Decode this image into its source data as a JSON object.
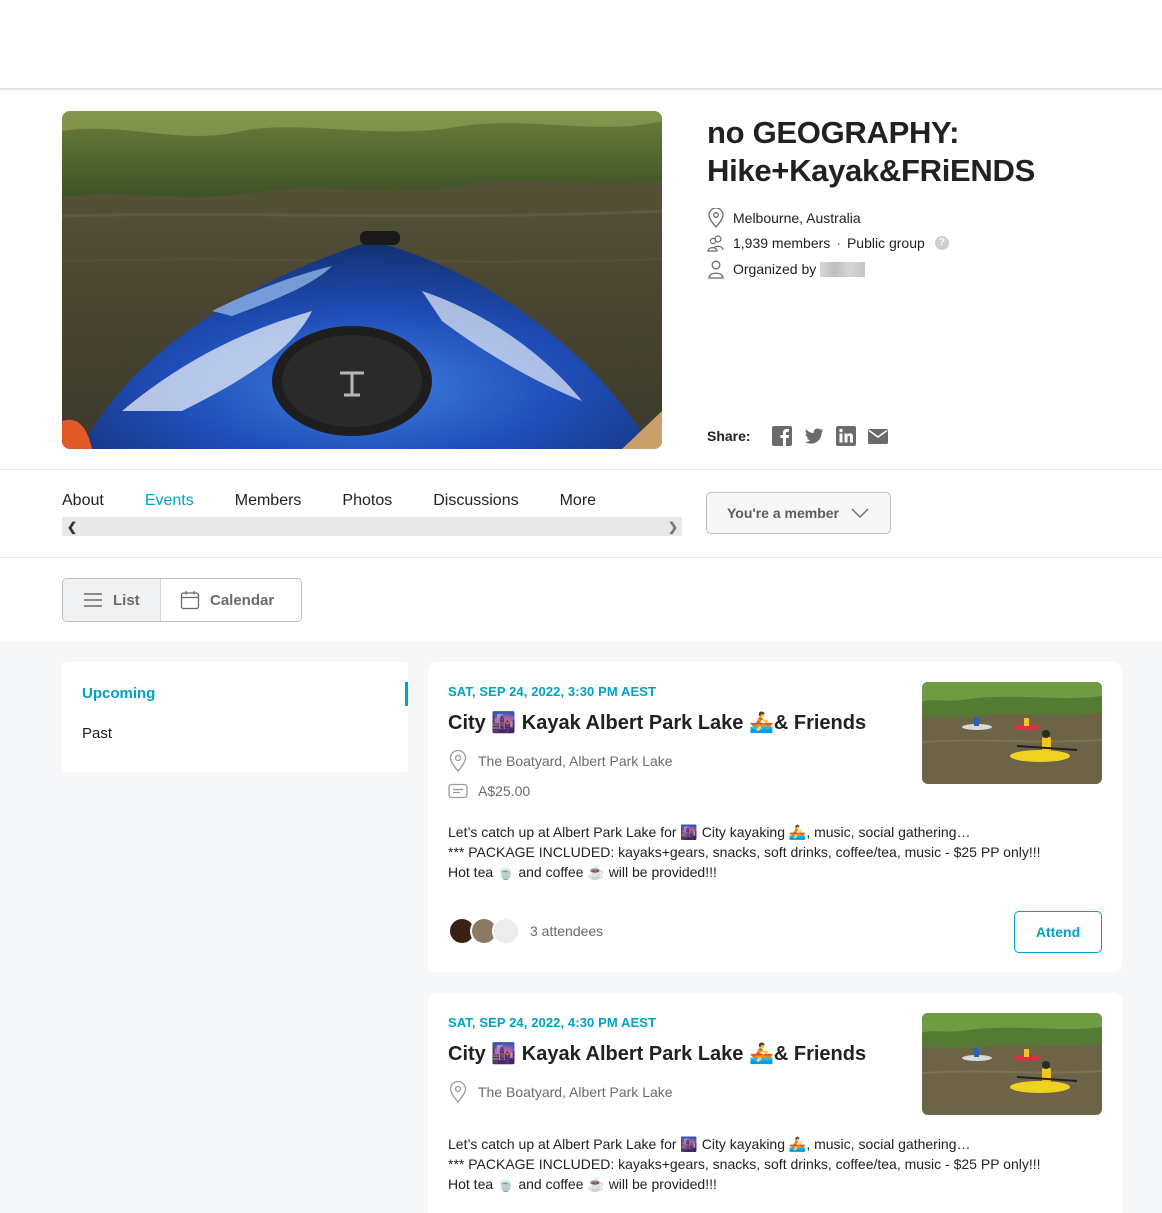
{
  "group": {
    "title_line1": "no GEOGRAPHY:",
    "title_line2": "Hike+Kayak&FRiENDS",
    "location": "Melbourne, Australia",
    "members": "1,939 members",
    "privacy": "Public group",
    "help": "?",
    "organized_by": "Organized by"
  },
  "share": {
    "label": "Share:",
    "icons": [
      "facebook-icon",
      "twitter-icon",
      "linkedin-icon",
      "email-icon"
    ]
  },
  "tabs": [
    {
      "label": "About",
      "active": false
    },
    {
      "label": "Events",
      "active": true
    },
    {
      "label": "Members",
      "active": false
    },
    {
      "label": "Photos",
      "active": false
    },
    {
      "label": "Discussions",
      "active": false
    },
    {
      "label": "More",
      "active": false
    }
  ],
  "membership": {
    "label": "You're a member"
  },
  "view_toggle": {
    "list": "List",
    "calendar": "Calendar"
  },
  "filter": {
    "upcoming": "Upcoming",
    "past": "Past"
  },
  "events": [
    {
      "date": "SAT, SEP 24, 2022, 3:30 PM AEST",
      "title": "City 🌆 Kayak Albert Park Lake 🚣&amp; Friends",
      "venue": "The Boatyard, Albert Park Lake",
      "price": "A$25.00",
      "desc1": "Let’s catch up at Albert Park Lake for 🌆 City kayaking 🚣, music, social gathering…",
      "desc2": "*** PACKAGE INCLUDED: kayaks+gears, snacks, soft drinks, coffee/tea, music - $25 PP only!!!",
      "desc3": "Hot tea 🍵 and coffee ☕ will be provided!!!",
      "attendees": "3 attendees",
      "action": "Attend"
    },
    {
      "date": "SAT, SEP 24, 2022, 4:30 PM AEST",
      "title": "City 🌆 Kayak Albert Park Lake 🚣&amp; Friends",
      "venue": "The Boatyard, Albert Park Lake",
      "desc1": "Let’s catch up at Albert Park Lake for 🌆 City kayaking 🚣, music, social gathering…",
      "desc2": "*** PACKAGE INCLUDED: kayaks+gears, snacks, soft drinks, coffee/tea, music - $25 PP only!!!",
      "desc3": "Hot tea 🍵 and coffee ☕ will be provided!!!"
    }
  ],
  "colors": {
    "accent": "#00a2c7",
    "text": "#212121",
    "muted": "#6b6b6b",
    "panel_bg": "#f6f7f8"
  }
}
